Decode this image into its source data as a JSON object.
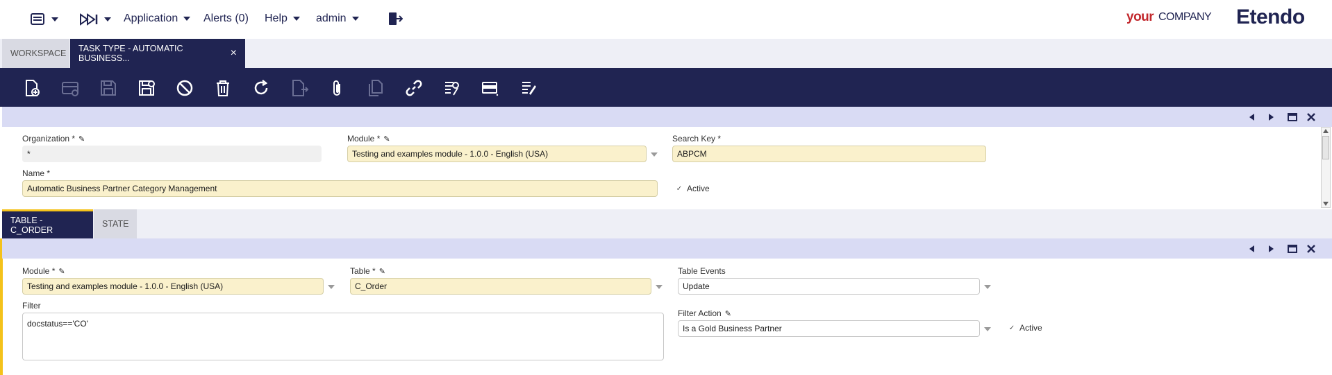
{
  "topbar": {
    "application_label": "Application",
    "alerts_label": "Alerts (0)",
    "help_label": "Help",
    "user_label": "admin",
    "brand_your": "your",
    "brand_company": "COMPANY",
    "brand_product": "Etendo"
  },
  "tabs": {
    "workspace": "WORKSPACE",
    "active": "TASK TYPE - AUTOMATIC BUSINESS...",
    "close_glyph": "×"
  },
  "toolbar": {
    "icons": [
      "new-record-icon",
      "new-row-icon",
      "save-icon",
      "save-close-icon",
      "cancel-icon",
      "delete-icon",
      "refresh-icon",
      "export-icon",
      "attachment-icon",
      "copy-icon",
      "link-icon",
      "audit-icon",
      "grid-view-icon",
      "notes-icon"
    ]
  },
  "header_form": {
    "organization": {
      "label": "Organization *",
      "value": "*"
    },
    "module": {
      "label": "Module *",
      "value": "Testing and examples module - 1.0.0 - English (USA)"
    },
    "search_key": {
      "label": "Search Key *",
      "value": "ABPCM"
    },
    "name": {
      "label": "Name *",
      "value": "Automatic Business Partner Category Management"
    },
    "active": {
      "label": "Active",
      "checked": true
    }
  },
  "subtabs": {
    "active": "TABLE - C_ORDER",
    "state": "STATE"
  },
  "child_form": {
    "module": {
      "label": "Module *",
      "value": "Testing and examples module - 1.0.0 - English (USA)"
    },
    "table": {
      "label": "Table *",
      "value": "C_Order"
    },
    "table_events": {
      "label": "Table Events",
      "value": "Update"
    },
    "filter": {
      "label": "Filter",
      "value": "docstatus=='CO'"
    },
    "filter_action": {
      "label": "Filter Action",
      "value": "Is a Gold Business Partner"
    },
    "active": {
      "label": "Active",
      "checked": true
    }
  },
  "colors": {
    "navy": "#202452",
    "header_bar": "#d9dbf4",
    "required_field": "#faf1cc",
    "accent": "#f4c21b",
    "brand_red": "#c2282d"
  },
  "glyphs": {
    "check": "✓",
    "pencil": "✎"
  }
}
